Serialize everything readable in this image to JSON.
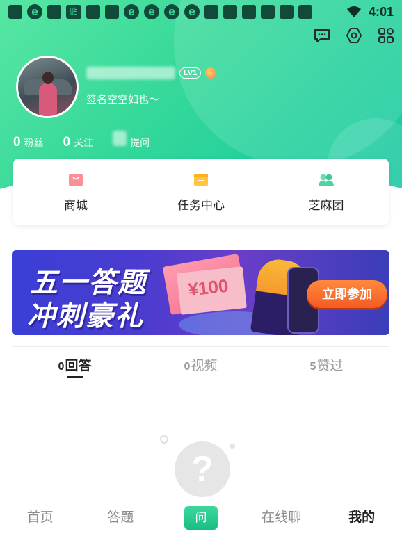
{
  "status_bar": {
    "time": "4:01",
    "tie_badge": "贴"
  },
  "profile": {
    "level_badge": "LV1",
    "signature": "签名空空如也～",
    "stats": [
      {
        "num": "0",
        "label": "粉丝"
      },
      {
        "num": "0",
        "label": "关注"
      },
      {
        "num": "",
        "label": "提问"
      }
    ]
  },
  "services": [
    {
      "label": "商城",
      "icon": "shopping-bag-icon"
    },
    {
      "label": "任务中心",
      "icon": "calendar-icon"
    },
    {
      "label": "芝麻团",
      "icon": "group-icon"
    }
  ],
  "banner": {
    "title_line1": "五一答题",
    "title_line2": "冲刺豪礼",
    "bill_text": "¥100",
    "cta": "立即参加"
  },
  "tabs": [
    {
      "count": "0",
      "label": "回答",
      "active": true
    },
    {
      "count": "0",
      "label": "视频",
      "active": false
    },
    {
      "count": "5",
      "label": "赞过",
      "active": false
    }
  ],
  "empty_state": {
    "glyph": "?"
  },
  "bottom_nav": [
    {
      "label": "首页"
    },
    {
      "label": "答题"
    },
    {
      "label": "问"
    },
    {
      "label": "在线聊"
    },
    {
      "label": "我的"
    }
  ],
  "colors": {
    "brand_green": "#2fd69b",
    "cta_orange": "#f56a2a"
  }
}
